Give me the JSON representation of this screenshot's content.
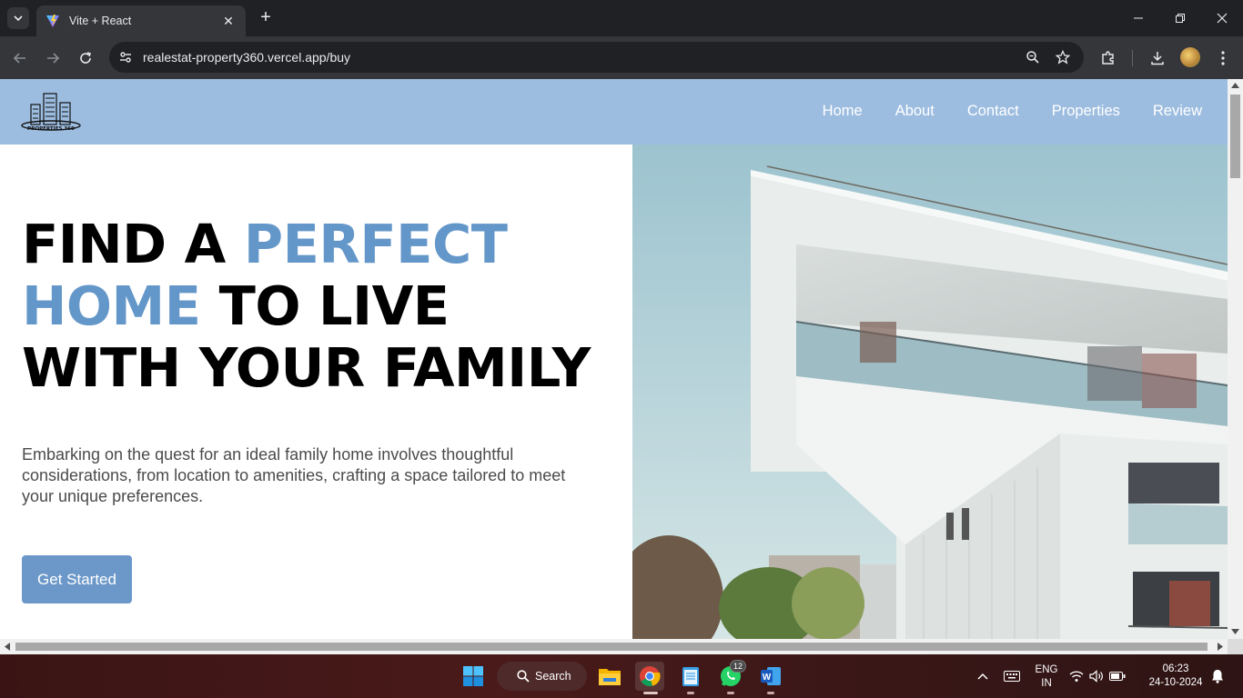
{
  "browser": {
    "tab_title": "Vite + React",
    "url": "realestat-property360.vercel.app/buy"
  },
  "site": {
    "logo_text": "PROPERTIES 360",
    "nav": [
      "Home",
      "About",
      "Contact",
      "Properties",
      "Review"
    ],
    "headline": {
      "part1": "FIND A ",
      "part2": "PERFECT",
      "part3": "HOME",
      "part4": " TO LIVE WITH YOUR FAMILY"
    },
    "description": "Embarking on the quest for an ideal family home involves thoughtful considerations, from location to amenities, crafting a space tailored to meet your unique preferences.",
    "cta_label": "Get Started",
    "accent_color": "#6497c9",
    "header_color": "#9dbde0"
  },
  "taskbar": {
    "search_label": "Search",
    "whatsapp_badge": "12",
    "lang_line1": "ENG",
    "lang_line2": "IN",
    "time": "06:23",
    "date": "24-10-2024"
  }
}
